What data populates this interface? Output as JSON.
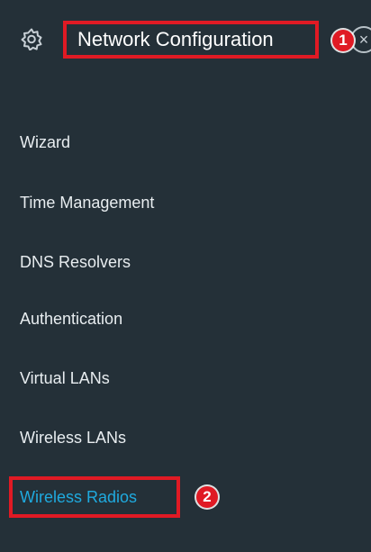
{
  "header": {
    "title": "Network Configuration",
    "icon": "gear-icon",
    "close_icon": "close-icon"
  },
  "menu": {
    "items": [
      {
        "label": "Wizard"
      },
      {
        "label": "Time Management"
      },
      {
        "label": "DNS Resolvers"
      },
      {
        "label": "Authentication"
      },
      {
        "label": "Virtual LANs"
      },
      {
        "label": "Wireless LANs"
      },
      {
        "label": "Wireless Radios",
        "active": true
      }
    ]
  },
  "annotations": {
    "badge_1": "1",
    "badge_2": "2"
  },
  "colors": {
    "background": "#243038",
    "highlight": "#e01a24",
    "active_text": "#1faadf",
    "text": "#e8edf0"
  }
}
